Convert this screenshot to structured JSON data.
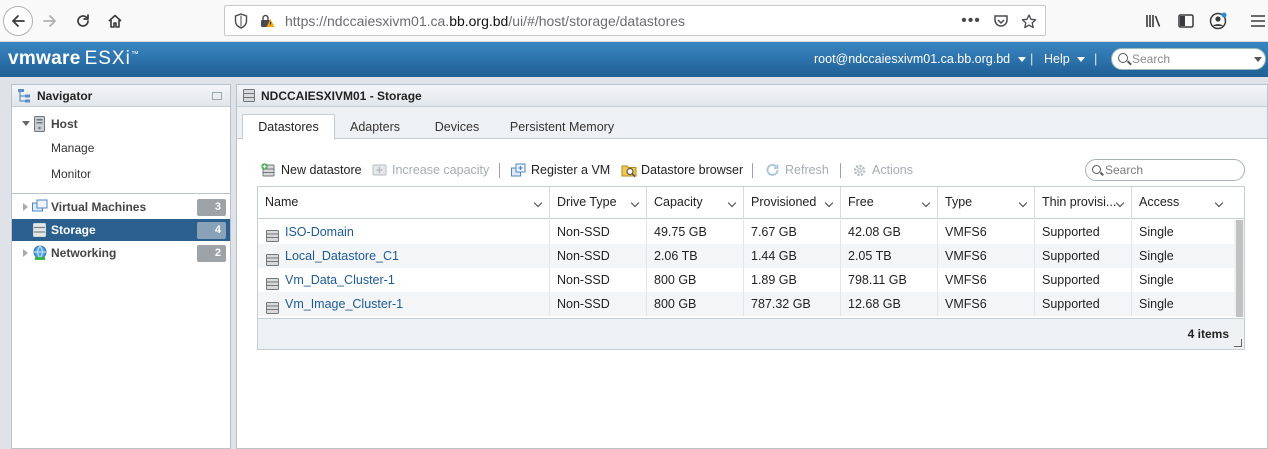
{
  "browser": {
    "url_prefix": "https://ndccaiesxivm01.ca.",
    "url_domain": "bb.org.bd",
    "url_suffix": "/ui/#/host/storage/datastores"
  },
  "header": {
    "logo_vm": "vmware",
    "logo_product": "ESXi",
    "user_menu": "root@ndccaiesxivm01.ca.bb.org.bd",
    "help_menu": "Help",
    "search_placeholder": "Search"
  },
  "navigator": {
    "title": "Navigator",
    "items": [
      {
        "label": "Host"
      },
      {
        "label": "Manage"
      },
      {
        "label": "Monitor"
      },
      {
        "label": "Virtual Machines",
        "badge": "3"
      },
      {
        "label": "Storage",
        "badge": "4"
      },
      {
        "label": "Networking",
        "badge": "2"
      }
    ]
  },
  "content": {
    "title": "NDCCAIESXIVM01 - Storage",
    "tabs": [
      "Datastores",
      "Adapters",
      "Devices",
      "Persistent Memory"
    ],
    "active_tab": "Datastores",
    "toolbar": {
      "new_datastore": "New datastore",
      "increase_capacity": "Increase capacity",
      "register_vm": "Register a VM",
      "datastore_browser": "Datastore browser",
      "refresh": "Refresh",
      "actions": "Actions",
      "search_placeholder": "Search"
    },
    "table": {
      "columns": [
        "Name",
        "Drive Type",
        "Capacity",
        "Provisioned",
        "Free",
        "Type",
        "Thin provisi...",
        "Access"
      ],
      "rows": [
        [
          "ISO-Domain",
          "Non-SSD",
          "49.75 GB",
          "7.67 GB",
          "42.08 GB",
          "VMFS6",
          "Supported",
          "Single"
        ],
        [
          "Local_Datastore_C1",
          "Non-SSD",
          "2.06 TB",
          "1.44 GB",
          "2.05 TB",
          "VMFS6",
          "Supported",
          "Single"
        ],
        [
          "Vm_Data_Cluster-1",
          "Non-SSD",
          "800 GB",
          "1.89 GB",
          "798.11 GB",
          "VMFS6",
          "Supported",
          "Single"
        ],
        [
          "Vm_Image_Cluster-1",
          "Non-SSD",
          "800 GB",
          "787.32 GB",
          "12.68 GB",
          "VMFS6",
          "Supported",
          "Single"
        ]
      ],
      "footer": "4 items"
    }
  },
  "colors": {
    "header_blue": "#2c72a8",
    "selected_nav": "#2a5f8e",
    "link_blue": "#1d5a9a"
  }
}
